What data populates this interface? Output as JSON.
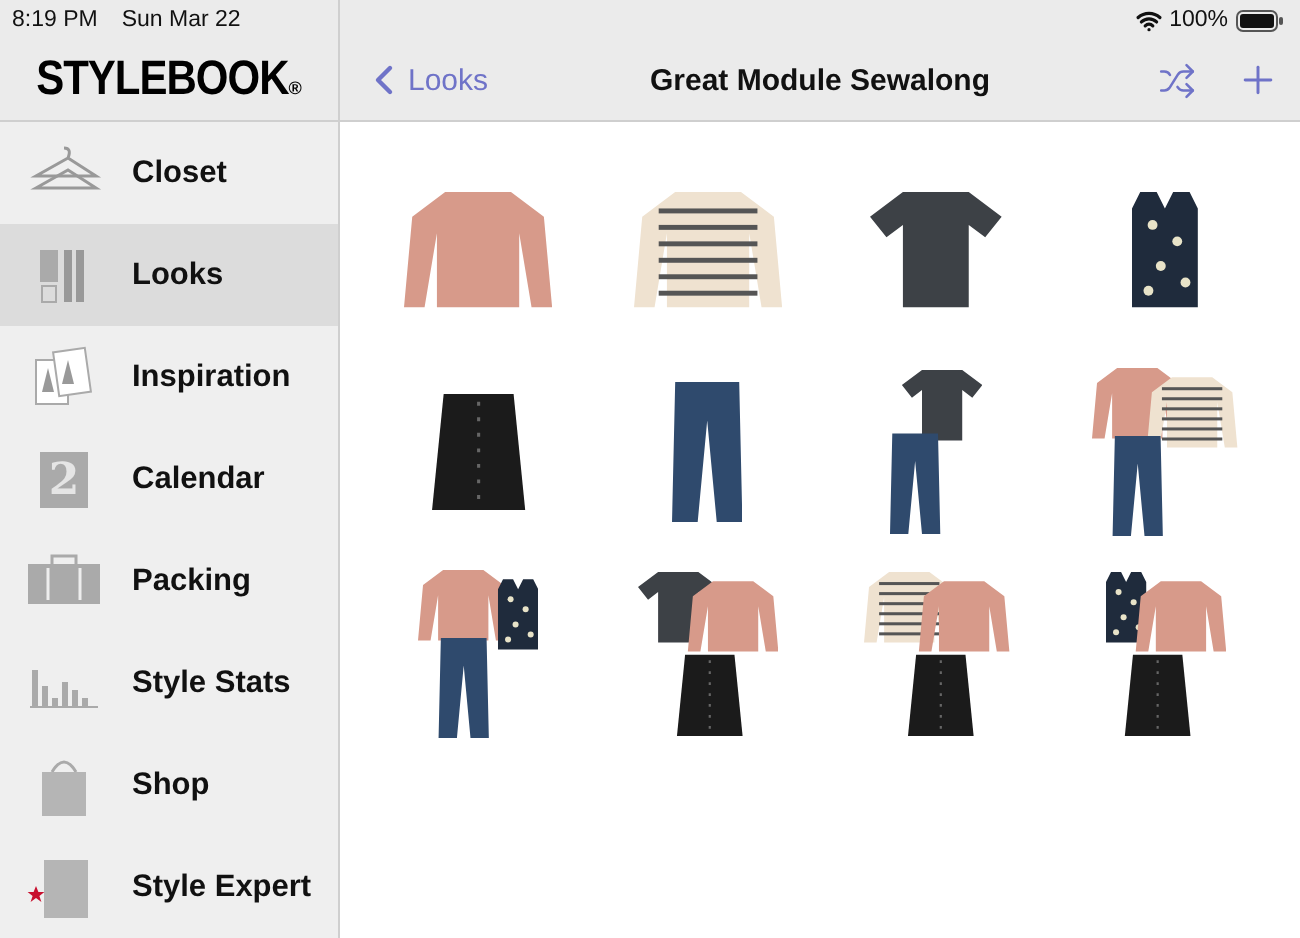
{
  "status_bar": {
    "time": "8:19 PM",
    "date": "Sun Mar 22",
    "battery": "100%"
  },
  "logo": {
    "name": "STYLEBOOK",
    "mark": "®"
  },
  "nav_bar": {
    "back": "Looks",
    "title": "Great Module Sewalong"
  },
  "sidebar": {
    "items": [
      {
        "label": "Closet",
        "selected": false
      },
      {
        "label": "Looks",
        "selected": true
      },
      {
        "label": "Inspiration",
        "selected": false
      },
      {
        "label": "Calendar",
        "selected": false,
        "icon_text": "2"
      },
      {
        "label": "Packing",
        "selected": false
      },
      {
        "label": "Style Stats",
        "selected": false
      },
      {
        "label": "Shop",
        "selected": false
      },
      {
        "label": "Style Expert",
        "selected": false
      }
    ]
  },
  "looks": [
    {
      "kind": "jacket"
    },
    {
      "kind": "striped"
    },
    {
      "kind": "tee"
    },
    {
      "kind": "tank"
    },
    {
      "kind": "skirt"
    },
    {
      "kind": "jeans"
    },
    {
      "kind": "tee-jeans"
    },
    {
      "kind": "jacket-striped-jeans"
    },
    {
      "kind": "jacket-tank-jeans"
    },
    {
      "kind": "tee-jacket-skirt"
    },
    {
      "kind": "striped-jacket-skirt"
    },
    {
      "kind": "tank-jacket-skirt"
    }
  ]
}
